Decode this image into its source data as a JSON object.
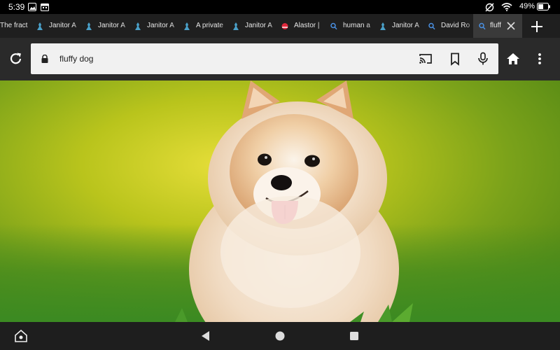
{
  "status_bar": {
    "time": "5:39",
    "battery_pct": "49%"
  },
  "tabs": [
    {
      "label": "The fract",
      "favicon": "none"
    },
    {
      "label": "Janitor A",
      "favicon": "janitor-icon"
    },
    {
      "label": "Janitor A",
      "favicon": "janitor-icon"
    },
    {
      "label": "Janitor A",
      "favicon": "janitor-icon"
    },
    {
      "label": "A private",
      "favicon": "janitor-icon"
    },
    {
      "label": "Janitor A",
      "favicon": "janitor-icon"
    },
    {
      "label": "Alastor |",
      "favicon": "red-circle-icon"
    },
    {
      "label": "human a",
      "favicon": "search-icon"
    },
    {
      "label": "Janitor A",
      "favicon": "janitor-icon"
    },
    {
      "label": "David Ro",
      "favicon": "search-icon"
    },
    {
      "label": "fluff",
      "favicon": "search-icon",
      "active": true
    }
  ],
  "omnibox": {
    "text": "fluffy dog"
  },
  "icons": [
    "reload-icon",
    "lock-icon",
    "cast-icon",
    "bookmark-icon",
    "mic-icon",
    "home-icon",
    "menu-icon",
    "close-icon",
    "plus-icon",
    "back-icon",
    "home-circle-icon",
    "recents-icon",
    "silk-icon"
  ],
  "colors": {
    "toolbar": "#2a2a2a",
    "tabstrip": "#1f1f1f",
    "active_tab": "#3a3a3a",
    "omnibox": "#f1f1f1",
    "search_fav": "#4a90e2",
    "alastor_fav": "#e0283c"
  }
}
